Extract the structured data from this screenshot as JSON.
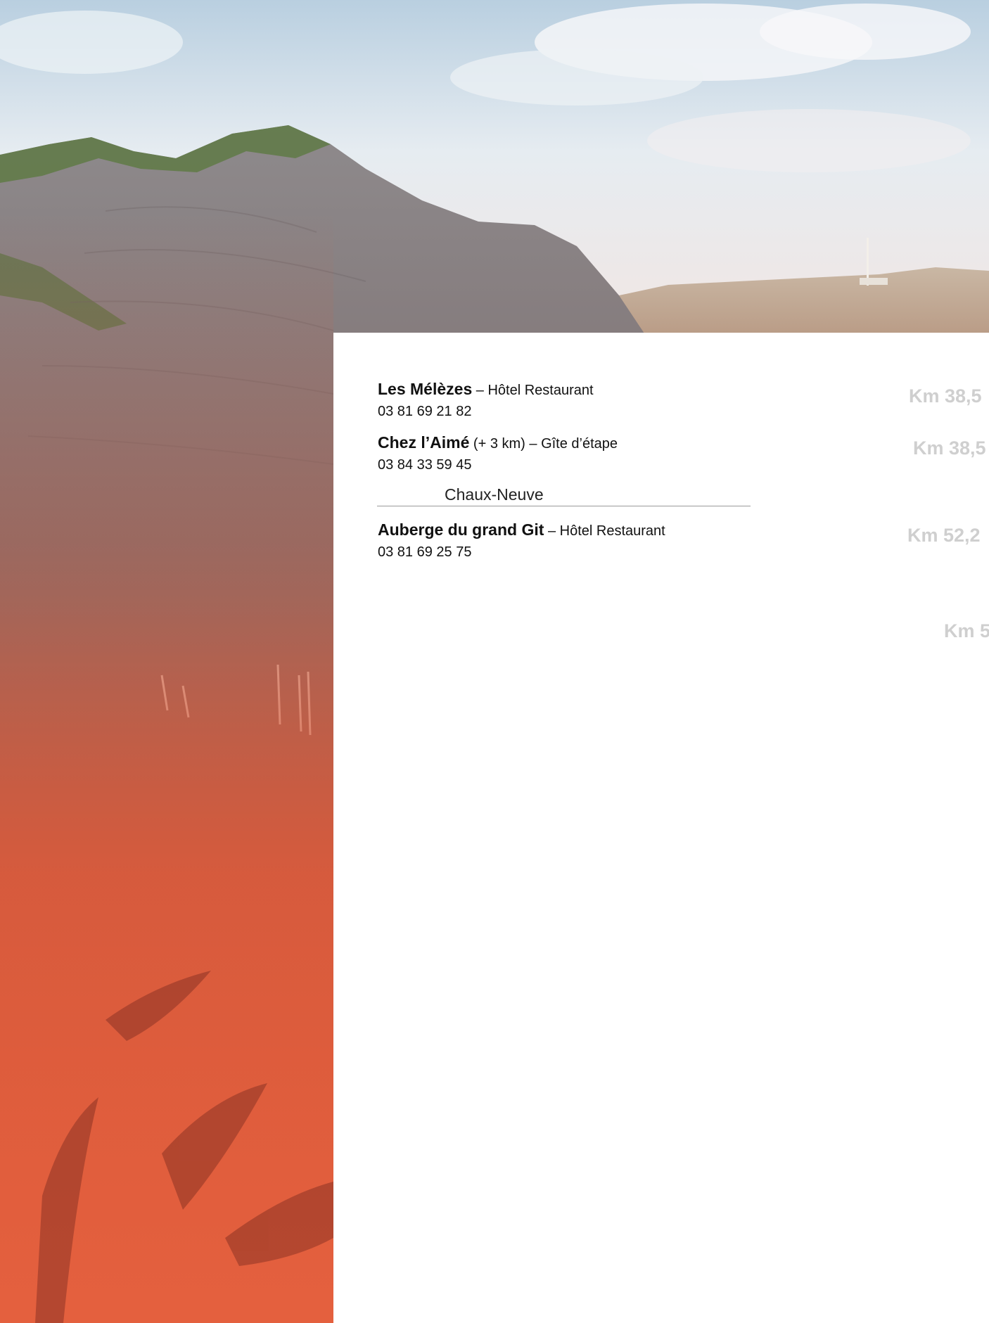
{
  "entries": [
    {
      "name": "Les Mélèzes",
      "detail": " – Hôtel Restaurant",
      "phone": "03 81 69 21 82"
    },
    {
      "name": "Chez l’Aimé",
      "detail": " (+ 3 km) – Gîte d’étape",
      "phone": "03 84 33 59 45"
    },
    {
      "name": "Auberge du grand Git",
      "detail": " – Hôtel Restaurant",
      "phone": "03 81 69 25 75"
    }
  ],
  "town": "Chaux-Neuve",
  "distances": [
    "Km 38,5",
    "Km 38,5",
    "Km 52,2",
    "Km 5"
  ],
  "colors": {
    "sky": "#dfe8ef",
    "rock": "#8a7f80",
    "overlay": "#e05a3a",
    "distance_text": "#cfcfcf",
    "rule": "#9a9a9a"
  }
}
